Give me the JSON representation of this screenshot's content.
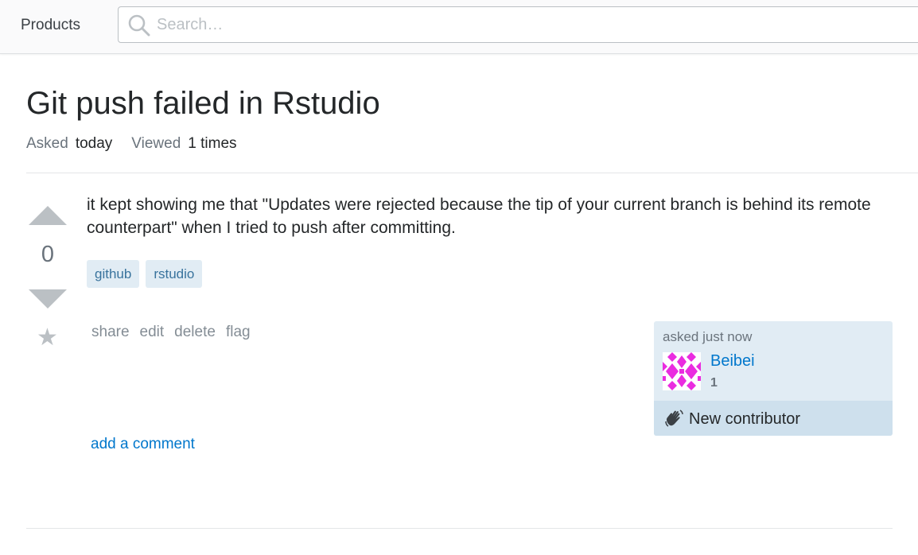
{
  "topbar": {
    "products_label": "Products",
    "search_placeholder": "Search…"
  },
  "question": {
    "title": "Git push failed in Rstudio",
    "meta": {
      "asked_label": "Asked",
      "asked_value": "today",
      "viewed_label": "Viewed",
      "viewed_value": "1 times"
    },
    "vote_count": "0",
    "body": "it kept showing me that \"Updates were rejected because the tip of your current branch is behind its remote counterpart\" when I tried to push after committing.",
    "tags": [
      "github",
      "rstudio"
    ],
    "menu": {
      "share": "share",
      "edit": "edit",
      "delete": "delete",
      "flag": "flag"
    },
    "owner": {
      "asked_time": "asked just now",
      "name": "Beibei",
      "reputation": "1",
      "new_contributor_label": "New contributor"
    },
    "add_comment": "add a comment"
  },
  "icons": {
    "search": "search-icon",
    "vote_up": "arrow-up-icon",
    "vote_down": "arrow-down-icon",
    "favorite": "star-icon",
    "wave": "waving-hand-icon"
  },
  "colors": {
    "link": "#0077cc",
    "tag_bg": "#e1ecf4",
    "tag_text": "#39739d",
    "owner_bg": "#e1ecf4",
    "new_contributor_bg": "#cee0ed",
    "avatar_accent": "#ea2ce0"
  }
}
